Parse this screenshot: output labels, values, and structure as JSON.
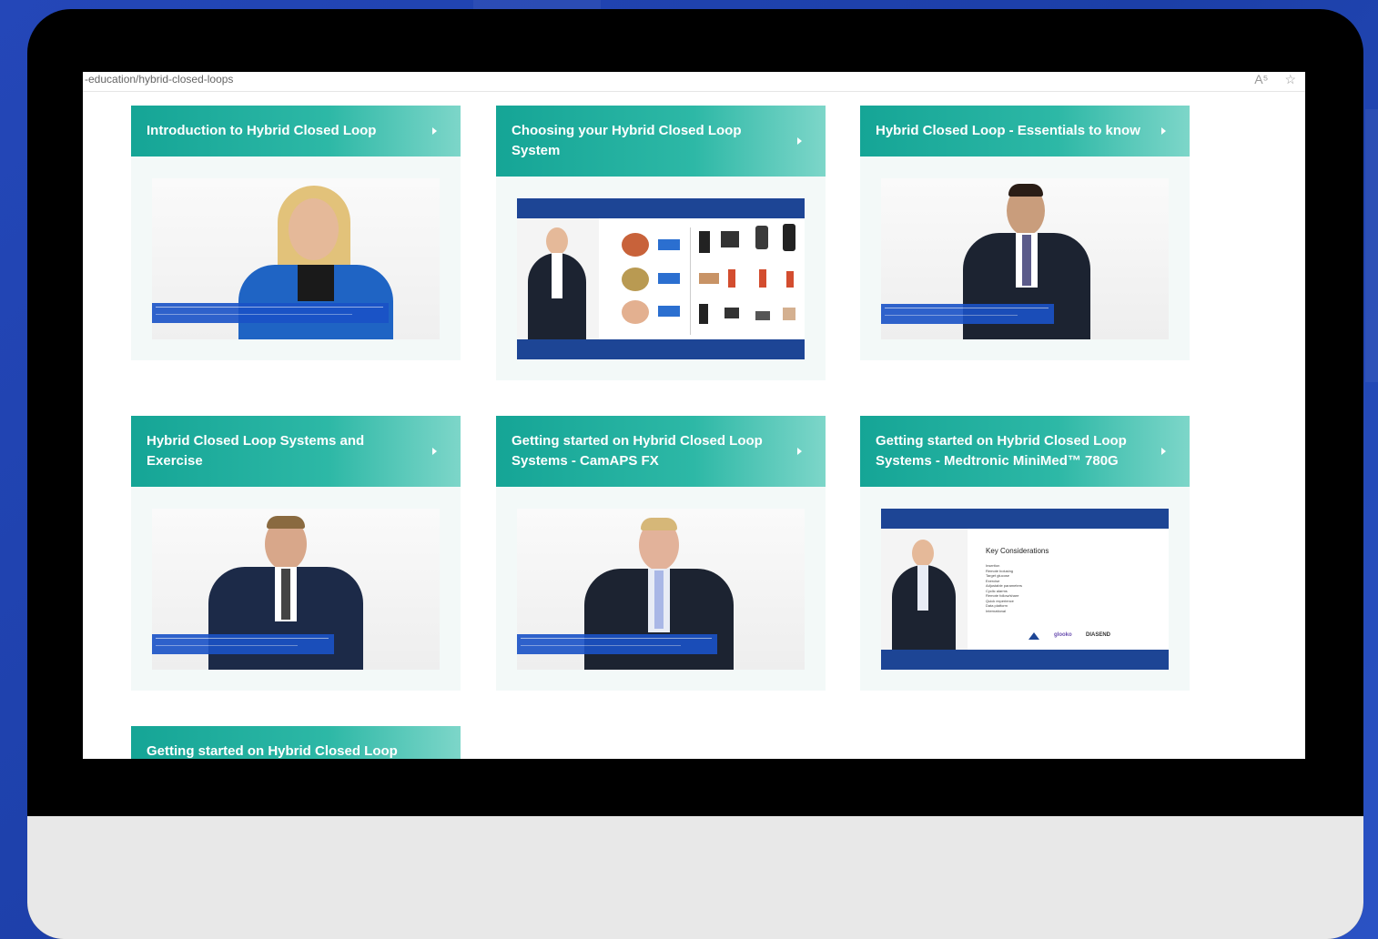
{
  "browser": {
    "url": "-education/hybrid-closed-loops",
    "read_aloud_icon": "A⁵",
    "favorite_icon": "☆"
  },
  "cards": [
    {
      "title": "Introduction to Hybrid Closed Loop"
    },
    {
      "title": "Choosing your Hybrid Closed Loop System"
    },
    {
      "title": "Hybrid Closed Loop - Essentials to know"
    },
    {
      "title": "Hybrid Closed Loop Systems and Exercise"
    },
    {
      "title": "Getting started on Hybrid Closed Loop Systems - CamAPS FX"
    },
    {
      "title": "Getting started on Hybrid Closed Loop Systems - Medtronic MiniMed™ 780G"
    },
    {
      "title": "Getting started on Hybrid Closed Loop"
    }
  ],
  "slide": {
    "heading": "Key Considerations",
    "bullets": [
      "Insertion",
      "Remote bolusing",
      "Target glucose",
      "Exercise",
      "Adjustable parameters",
      "Cyclic alarms",
      "Remote follow/share",
      "Quick experience",
      "Data platform",
      "International"
    ],
    "logos": [
      "glooko",
      "DIASEND"
    ]
  }
}
